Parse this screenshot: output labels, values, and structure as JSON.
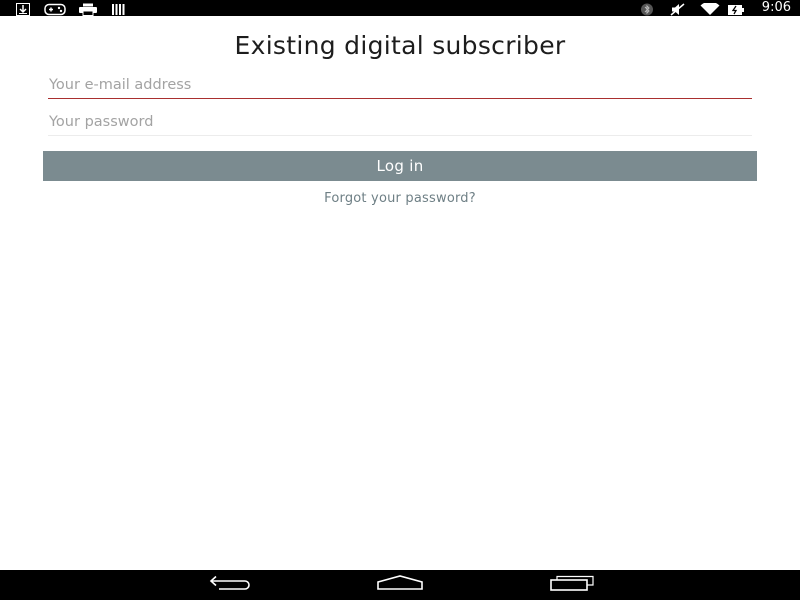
{
  "status_bar": {
    "time": "9:06",
    "left_icons": [
      "download-icon",
      "gamepad-icon",
      "print-icon",
      "barcode-icon"
    ],
    "right_icons": [
      "bluetooth-icon",
      "mute-icon",
      "wifi-icon",
      "battery-icon"
    ]
  },
  "login": {
    "title": "Existing digital subscriber",
    "email_placeholder": "Your e-mail address",
    "email_value": "",
    "password_placeholder": "Your password",
    "password_value": "",
    "login_label": "Log in",
    "forgot_label": "Forgot your password?"
  },
  "nav_bar": {
    "buttons": [
      "back-icon",
      "home-icon",
      "recents-icon"
    ]
  },
  "colors": {
    "button_bg": "#7b8b90",
    "link": "#6e7f85",
    "email_underline": "#a92f2f"
  }
}
